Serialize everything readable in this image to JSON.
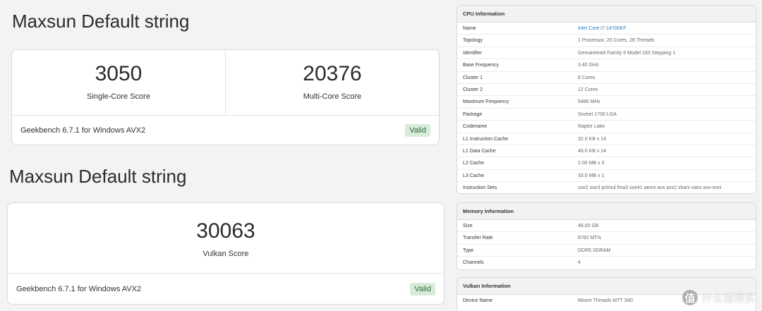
{
  "sections": [
    {
      "title": "Maxsun Default string",
      "scores": [
        {
          "value": "3050",
          "label": "Single-Core Score"
        },
        {
          "value": "20376",
          "label": "Multi-Core Score"
        }
      ],
      "footer": "Geekbench 6.7.1 for Windows AVX2",
      "badge": "Valid"
    },
    {
      "title": "Maxsun Default string",
      "scores": [
        {
          "value": "30063",
          "label": "Vulkan Score"
        }
      ],
      "footer": "Geekbench 6.7.1 for Windows AVX2",
      "badge": "Valid"
    }
  ],
  "cpu_info": {
    "header": "CPU Information",
    "rows": [
      {
        "key": "Name",
        "value": "Intel Core i7-14700KF"
      },
      {
        "key": "Topology",
        "value": "1 Processor, 20 Cores, 28 Threads"
      },
      {
        "key": "Identifier",
        "value": "GenuineIntel Family 6 Model 183 Stepping 1"
      },
      {
        "key": "Base Frequency",
        "value": "3.40 GHz"
      },
      {
        "key": "Cluster 1",
        "value": "8 Cores"
      },
      {
        "key": "Cluster 2",
        "value": "12 Cores"
      },
      {
        "key": "Maximum Frequency",
        "value": "5486 MHz"
      },
      {
        "key": "Package",
        "value": "Socket 1700 LGA"
      },
      {
        "key": "Codename",
        "value": "Raptor Lake"
      },
      {
        "key": "L1 Instruction Cache",
        "value": "32.0 KB x 14"
      },
      {
        "key": "L1 Data Cache",
        "value": "48.0 KB x 14"
      },
      {
        "key": "L2 Cache",
        "value": "2.00 MB x 3"
      },
      {
        "key": "L3 Cache",
        "value": "33.0 MB x 1"
      },
      {
        "key": "Instruction Sets",
        "value": "sse2 sse3 pclmul fma3 sse41 aesni avx avx2 shani vaes avx-vnni"
      }
    ]
  },
  "memory_info": {
    "header": "Memory Information",
    "rows": [
      {
        "key": "Size",
        "value": "48.00 GB"
      },
      {
        "key": "Transfer Rate",
        "value": "6782 MT/s"
      },
      {
        "key": "Type",
        "value": "DDR5 SDRAM"
      },
      {
        "key": "Channels",
        "value": "4"
      }
    ]
  },
  "vulkan_info": {
    "header": "Vulkan Information",
    "rows": [
      {
        "key": "Device Name",
        "value": "Moore Threads MTT S80"
      }
    ]
  },
  "watermark": {
    "icon": "值",
    "text": "什么值得买"
  }
}
